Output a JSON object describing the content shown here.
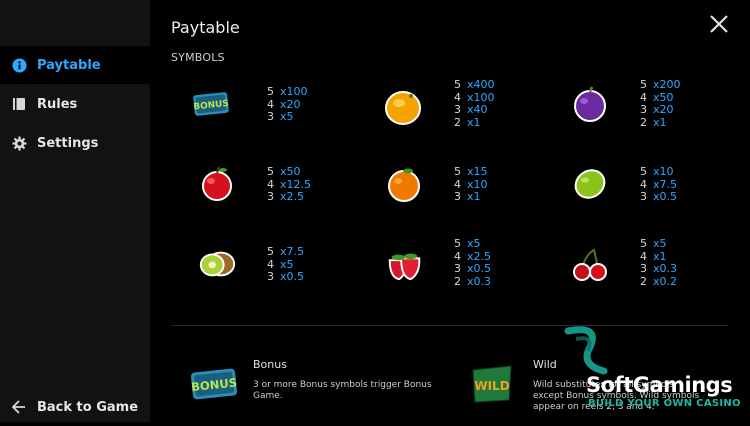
{
  "sidebar": {
    "items": [
      {
        "label": "Paytable",
        "icon": "info-icon",
        "active": true
      },
      {
        "label": "Rules",
        "icon": "book-icon",
        "active": false
      },
      {
        "label": "Settings",
        "icon": "gear-icon",
        "active": false
      }
    ],
    "back_label": "Back to Game"
  },
  "header": {
    "title": "Paytable",
    "section": "SYMBOLS"
  },
  "colors": {
    "accent": "#2ea7ff",
    "sidebar_bg": "#121212",
    "main_bg": "#000000"
  },
  "symbols": [
    {
      "name": "Bonus",
      "icon": "bonus-icon",
      "pays": [
        [
          "5",
          "x100"
        ],
        [
          "4",
          "x20"
        ],
        [
          "3",
          "x5"
        ]
      ]
    },
    {
      "name": "Orange Slice",
      "icon": "citrus-icon",
      "pays": [
        [
          "5",
          "x400"
        ],
        [
          "4",
          "x100"
        ],
        [
          "3",
          "x40"
        ],
        [
          "2",
          "x1"
        ]
      ]
    },
    {
      "name": "Plum",
      "icon": "plum-icon",
      "pays": [
        [
          "5",
          "x200"
        ],
        [
          "4",
          "x50"
        ],
        [
          "3",
          "x20"
        ],
        [
          "2",
          "x1"
        ]
      ]
    },
    {
      "name": "Apple",
      "icon": "apple-icon",
      "pays": [
        [
          "5",
          "x50"
        ],
        [
          "4",
          "x12.5"
        ],
        [
          "3",
          "x2.5"
        ]
      ]
    },
    {
      "name": "Orange",
      "icon": "orange-icon",
      "pays": [
        [
          "5",
          "x15"
        ],
        [
          "4",
          "x10"
        ],
        [
          "3",
          "x1"
        ]
      ]
    },
    {
      "name": "Lime",
      "icon": "lime-icon",
      "pays": [
        [
          "5",
          "x10"
        ],
        [
          "4",
          "x7.5"
        ],
        [
          "3",
          "x0.5"
        ]
      ]
    },
    {
      "name": "Kiwi",
      "icon": "kiwi-icon",
      "pays": [
        [
          "5",
          "x7.5"
        ],
        [
          "4",
          "x5"
        ],
        [
          "3",
          "x0.5"
        ]
      ]
    },
    {
      "name": "Strawberry",
      "icon": "strawberry-icon",
      "pays": [
        [
          "5",
          "x5"
        ],
        [
          "4",
          "x2.5"
        ],
        [
          "3",
          "x0.5"
        ],
        [
          "2",
          "x0.3"
        ]
      ]
    },
    {
      "name": "Cherry",
      "icon": "cherry-icon",
      "pays": [
        [
          "5",
          "x5"
        ],
        [
          "4",
          "x1"
        ],
        [
          "3",
          "x0.3"
        ],
        [
          "2",
          "x0.2"
        ]
      ]
    }
  ],
  "features": [
    {
      "title": "Bonus",
      "icon_text": "BONUS",
      "desc": "3 or more Bonus symbols trigger Bonus Game."
    },
    {
      "title": "Wild",
      "icon_text": "WILD",
      "desc": "Wild substitutes for all symbols except Bonus symbols. Wild symbols appear on reels 2, 3 and 4."
    }
  ],
  "watermark": {
    "name": "SoftGamings",
    "tagline": "BUILD YOUR OWN CASINO"
  }
}
